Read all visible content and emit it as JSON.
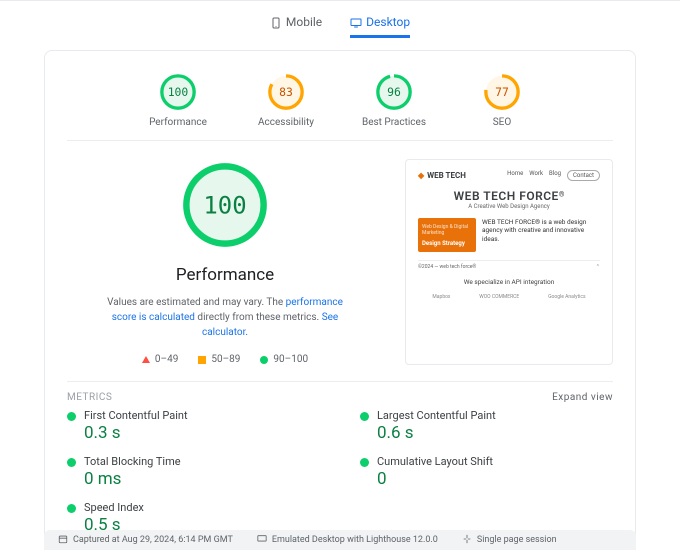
{
  "tabs": {
    "mobile": "Mobile",
    "desktop": "Desktop",
    "active": "desktop"
  },
  "gauges": {
    "performance": {
      "score": "100",
      "label": "Performance",
      "pct": 100,
      "color": "#0cce6b"
    },
    "accessibility": {
      "score": "83",
      "label": "Accessibility",
      "pct": 83,
      "color": "#ffa400"
    },
    "best": {
      "score": "96",
      "label": "Best Practices",
      "pct": 96,
      "color": "#0cce6b"
    },
    "seo": {
      "score": "77",
      "label": "SEO",
      "pct": 77,
      "color": "#ffa400"
    }
  },
  "big": {
    "score": "100",
    "title": "Performance",
    "desc_prefix": "Values are estimated and may vary. The ",
    "desc_link1": "performance score is calculated",
    "desc_mid": " directly from these metrics. ",
    "desc_link2": "See calculator."
  },
  "legend": {
    "bad": "0–49",
    "avg": "50–89",
    "good": "90–100"
  },
  "thumb": {
    "brand": "WEB TECH",
    "nav1": "Home",
    "nav2": "Work",
    "nav3": "Blog",
    "btn": "Contact",
    "title": "WEB TECH FORCE",
    "reg": "®",
    "sub": "A Creative Web Design Agency",
    "banner_tag": "Design Strategy",
    "copy": "WEB TECH FORCE® is a web design agency with creative and innovative ideas.",
    "foot_left": "©2024 — web tech force®",
    "mid": "We specialize in API integration",
    "logo1": "Mapbox",
    "logo2": "WOO COMMERCE",
    "logo3": "Google Analytics"
  },
  "metrics": {
    "head": "METRICS",
    "expand": "Expand view",
    "fcp": {
      "label": "First Contentful Paint",
      "value": "0.3 s"
    },
    "lcp": {
      "label": "Largest Contentful Paint",
      "value": "0.6 s"
    },
    "tbt": {
      "label": "Total Blocking Time",
      "value": "0 ms"
    },
    "cls": {
      "label": "Cumulative Layout Shift",
      "value": "0"
    },
    "si": {
      "label": "Speed Index",
      "value": "0.5 s"
    }
  },
  "footer": {
    "captured": "Captured at Aug 29, 2024, 6:14 PM GMT",
    "emulated": "Emulated Desktop with Lighthouse 12.0.0",
    "session": "Single page session"
  }
}
